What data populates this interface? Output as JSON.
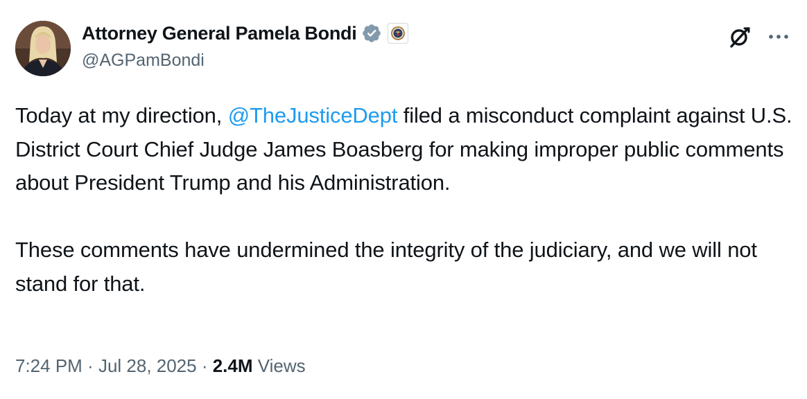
{
  "author": {
    "display_name": "Attorney General Pamela Bondi",
    "handle": "@AGPamBondi",
    "verified_badge_icon": "verified-checkmark-icon",
    "affiliate_badge_icon": "doj-seal-icon"
  },
  "actions": {
    "grok_icon": "grok-icon",
    "more_icon": "more-options-icon"
  },
  "tweet": {
    "line1_before_mention": "Today at my direction, ",
    "mention": "@TheJusticeDept",
    "line1_after_mention": " filed a misconduct complaint against U.S. District Court Chief Judge James Boasberg for making improper public comments about President Trump and his Administration.",
    "paragraph2": "These comments have undermined the integrity of the judiciary, and we will not stand for that."
  },
  "meta": {
    "time": "7:24 PM",
    "separator": " · ",
    "date": "Jul 28, 2025",
    "views_count": "2.4M",
    "views_label": " Views"
  },
  "colors": {
    "link": "#1d9bf0",
    "secondary_text": "#536471",
    "primary_text": "#0f1419",
    "verified": "#829aab"
  }
}
